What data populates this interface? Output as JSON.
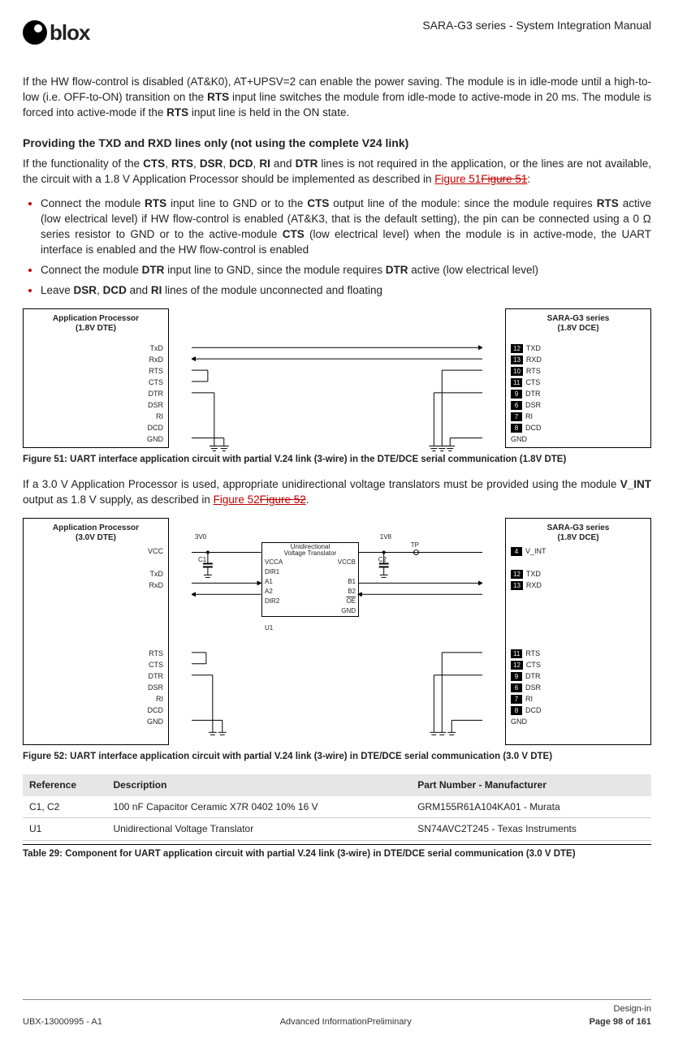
{
  "header": {
    "logo_text": "blox",
    "doc_title": "SARA-G3 series - System Integration Manual"
  },
  "para1_pre": "If the HW flow-control is disabled (AT&K0), AT+UPSV=2 can enable the power saving. The module is in idle-mode until a high-to-low (i.e. OFF-to-ON) transition on the ",
  "para1_b1": "RTS",
  "para1_mid": " input line switches the module from idle-mode to active-mode in 20 ms. The module is forced into active-mode if the ",
  "para1_b2": "RTS",
  "para1_post": " input line is held in the ON state.",
  "section1_title": "Providing the TXD and RXD lines only (not using the complete V24 link)",
  "para2_a": "If the functionality of the ",
  "para2_cts": "CTS",
  "para2_rts": "RTS",
  "para2_dsr": "DSR",
  "para2_dcd": "DCD",
  "para2_ri": "RI",
  "para2_dtr": "DTR",
  "para2_b": " lines is not required in the application, or the lines are not available, the circuit with a 1.8 V Application Processor should be implemented as described in ",
  "figref51_a": "Figure 51",
  "figref51_b": "Figure 51",
  "colon": ":",
  "bullet1_a": "Connect the module ",
  "bullet1_rts": "RTS",
  "bullet1_b": " input line to GND or to the ",
  "bullet1_cts": "CTS",
  "bullet1_c": " output line of the module: since the module requires ",
  "bullet1_rts2": "RTS",
  "bullet1_d": " active (low electrical level) if HW flow-control is enabled (AT&K3, that is the default setting), the pin can be connected using a 0 ",
  "bullet1_e": " series resistor to GND or to the active-module ",
  "bullet1_cts2": "CTS",
  "bullet1_f": " (low electrical level) when the module is in active-mode, the UART interface is enabled and the HW flow-control is enabled",
  "bullet2_a": "Connect the module ",
  "bullet2_dtr": "DTR",
  "bullet2_b": " input line to GND, since the module requires ",
  "bullet2_dtr2": "DTR",
  "bullet2_c": " active (low electrical level)",
  "bullet3_a": "Leave ",
  "bullet3_dsr": "DSR",
  "bullet3_b": ", ",
  "bullet3_dcd": "DCD",
  "bullet3_c": " and ",
  "bullet3_ri": "RI",
  "bullet3_d": " lines of the module unconnected and floating",
  "fig51": {
    "left_title": "Application Processor\n(1.8V DTE)",
    "right_title": "SARA-G3 series\n(1.8V DCE)",
    "left_pins": [
      "TxD",
      "RxD",
      "RTS",
      "CTS",
      "DTR",
      "DSR",
      "RI",
      "DCD",
      "GND"
    ],
    "right_pins": [
      {
        "n": "12",
        "l": "TXD"
      },
      {
        "n": "13",
        "l": "RXD"
      },
      {
        "n": "10",
        "l": "RTS"
      },
      {
        "n": "11",
        "l": "CTS"
      },
      {
        "n": "9",
        "l": "DTR"
      },
      {
        "n": "6",
        "l": "DSR"
      },
      {
        "n": "7",
        "l": "RI"
      },
      {
        "n": "8",
        "l": "DCD"
      },
      {
        "n": "",
        "l": "GND"
      }
    ],
    "caption": "Figure 51: UART interface application circuit with partial V.24 link (3-wire) in the DTE/DCE serial communication (1.8V DTE)"
  },
  "para3_a": "If a 3.0 V Application Processor is used, appropriate unidirectional voltage translators must be provided using the module ",
  "para3_vint": "V_INT",
  "para3_b": " output as 1.8 V supply, as described in ",
  "figref52_a": "Figure 52",
  "figref52_b": "Figure 52",
  "fig52": {
    "left_title": "Application Processor\n(3.0V DTE)",
    "right_title": "SARA-G3 series\n(1.8V DCE)",
    "v3": "3V0",
    "v18": "1V8",
    "tp": "TP",
    "trans_hdr": "Unidirectional\nVoltage Translator",
    "trans_rows_l": [
      "VCCA",
      "DIR1",
      "A1",
      "A2",
      "DIR2"
    ],
    "trans_rows_r": [
      "VCCB",
      "",
      "B1",
      "B2",
      "OE",
      "GND"
    ],
    "u1": "U1",
    "c1": "C1",
    "c2": "C2",
    "left_pins_top": [
      "VCC",
      "",
      "TxD",
      "RxD"
    ],
    "left_pins_bot": [
      "RTS",
      "CTS",
      "DTR",
      "DSR",
      "RI",
      "DCD",
      "GND"
    ],
    "right_pins_top": [
      {
        "n": "4",
        "l": "V_INT"
      },
      {
        "n": "",
        "l": ""
      },
      {
        "n": "12",
        "l": "TXD"
      },
      {
        "n": "13",
        "l": "RXD"
      }
    ],
    "right_pins_bot": [
      {
        "n": "11",
        "l": "RTS"
      },
      {
        "n": "12",
        "l": "CTS"
      },
      {
        "n": "9",
        "l": "DTR"
      },
      {
        "n": "6",
        "l": "DSR"
      },
      {
        "n": "7",
        "l": "RI"
      },
      {
        "n": "8",
        "l": "DCD"
      },
      {
        "n": "",
        "l": "GND"
      }
    ],
    "caption": "Figure 52: UART interface application circuit with partial V.24 link (3-wire) in DTE/DCE serial communication (3.0 V DTE)"
  },
  "table": {
    "headers": [
      "Reference",
      "Description",
      "Part Number - Manufacturer"
    ],
    "rows": [
      [
        "C1, C2",
        "100 nF Capacitor Ceramic X7R 0402 10% 16 V",
        "GRM155R61A104KA01 - Murata"
      ],
      [
        "U1",
        "Unidirectional Voltage Translator",
        "SN74AVC2T245 - Texas Instruments"
      ]
    ],
    "caption": "Table 29: Component for UART application circuit with partial V.24 link (3-wire) in DTE/DCE serial communication (3.0 V DTE)"
  },
  "footer": {
    "left": "UBX-13000995 - A1",
    "center": "Advanced InformationPreliminary",
    "right_top": "Design-in",
    "right_bot": "Page 98 of 161"
  }
}
